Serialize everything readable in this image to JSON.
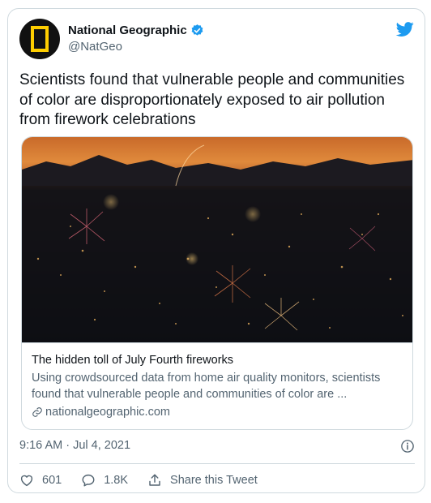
{
  "account": {
    "display_name": "National Geographic",
    "handle": "@NatGeo"
  },
  "tweet": {
    "text": "Scientists found that vulnerable people and communities of color are disproportionately exposed to air pollution from firework celebrations",
    "timestamp": "9:16 AM · Jul 4, 2021"
  },
  "link_card": {
    "title": "The hidden toll of July Fourth fireworks",
    "description": "Using crowdsourced data from home air quality monitors, scientists found that vulnerable people and communities of color are ...",
    "domain": "nationalgeographic.com"
  },
  "actions": {
    "likes": "601",
    "replies": "1.8K",
    "share_label": "Share this Tweet"
  },
  "colors": {
    "twitter_blue": "#1d9bf0",
    "natgeo_yellow": "#ffce00",
    "secondary_text": "#536471",
    "border": "#cfd9de"
  },
  "icons": [
    "twitter-bird-icon",
    "verified-badge-icon",
    "link-icon",
    "info-icon",
    "heart-icon",
    "reply-icon",
    "share-icon"
  ]
}
